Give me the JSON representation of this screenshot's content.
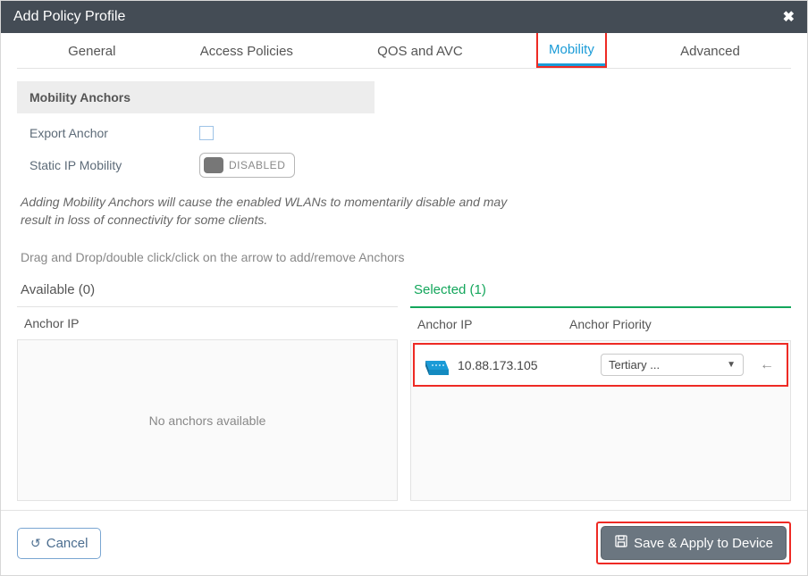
{
  "modal": {
    "title": "Add Policy Profile"
  },
  "tabs": {
    "general": "General",
    "access_policies": "Access Policies",
    "qos_avc": "QOS and AVC",
    "mobility": "Mobility",
    "advanced": "Advanced"
  },
  "section": {
    "header": "Mobility Anchors",
    "export_anchor_label": "Export Anchor",
    "static_ip_label": "Static IP Mobility",
    "static_ip_state": "DISABLED",
    "warning": "Adding Mobility Anchors will cause the enabled WLANs to momentarily disable and may result in loss of connectivity for some clients.",
    "hint": "Drag and Drop/double click/click on the arrow to add/remove Anchors"
  },
  "available": {
    "title": "Available (0)",
    "column_ip": "Anchor IP",
    "empty": "No anchors available"
  },
  "selected": {
    "title": "Selected (1)",
    "column_ip": "Anchor IP",
    "column_priority": "Anchor Priority",
    "rows": [
      {
        "ip": "10.88.173.105",
        "priority": "Tertiary ..."
      }
    ]
  },
  "footer": {
    "cancel": "Cancel",
    "save": "Save & Apply to Device"
  }
}
